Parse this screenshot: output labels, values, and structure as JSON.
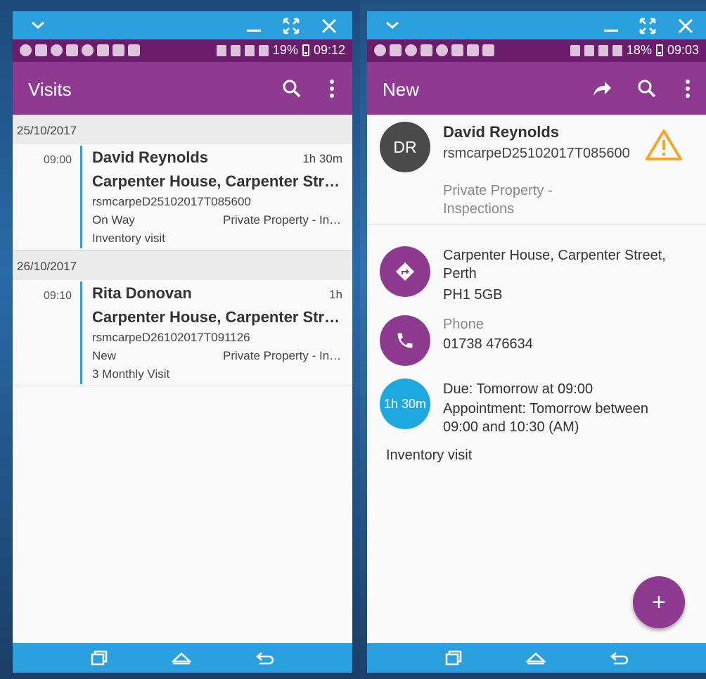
{
  "colors": {
    "window_bar": "#2aa0de",
    "status_bar": "#6b1d6b",
    "app_bar": "#8e3a91",
    "accent_blue": "#1ea8e0",
    "warning": "#f5a623",
    "avatar_bg": "#4a4a4a"
  },
  "left": {
    "status": {
      "battery": "19%",
      "time": "09:12"
    },
    "appbar": {
      "title": "Visits",
      "icons": [
        "search-icon",
        "more-vert-icon"
      ]
    },
    "groups": [
      {
        "date": "25/10/2017",
        "visit": {
          "time": "09:00",
          "name": "David Reynolds",
          "duration": "1h 30m",
          "address": "Carpenter House, Carpenter Street, Perth",
          "ref": "rsmcarpeD25102017T085600",
          "status": "On Way",
          "property": "Private Property - Inspections",
          "note": "Inventory visit"
        }
      },
      {
        "date": "26/10/2017",
        "visit": {
          "time": "09:10",
          "name": "Rita Donovan",
          "duration": "1h",
          "address": "Carpenter House, Carpenter Street, Perth",
          "ref": "rsmcarpeD26102017T091126",
          "status": "New",
          "property": "Private Property - Inspections",
          "note": "3 Monthly Visit"
        }
      }
    ]
  },
  "right": {
    "status": {
      "battery": "18%",
      "time": "09:03"
    },
    "appbar": {
      "title": "New",
      "icons": [
        "share-icon",
        "search-icon",
        "more-vert-icon"
      ]
    },
    "contact": {
      "initials": "DR",
      "name": "David Reynolds",
      "ref": "rsmcarpeD25102017T085600",
      "type": "Private Property - Inspections"
    },
    "address": {
      "line1": "Carpenter House, Carpenter Street, Perth",
      "line2": "PH1 5GB"
    },
    "phone": {
      "label": "Phone",
      "number": "01738 476634"
    },
    "schedule": {
      "duration": "1h 30m",
      "due": "Due: Tomorrow at 09:00",
      "appointment": "Appointment: Tomorrow between 09:00 and 10:30 (AM)"
    },
    "note": "Inventory visit",
    "fab_label": "+"
  }
}
